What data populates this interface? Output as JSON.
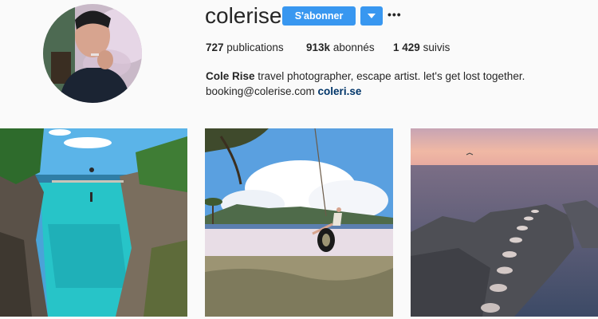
{
  "profile": {
    "username": "colerise",
    "follow_label": "S'abonner",
    "more_label": "•••",
    "stats": {
      "posts_count": "727",
      "posts_label": "publications",
      "followers_count": "913k",
      "followers_label": "abonnés",
      "following_count": "1 429",
      "following_label": "suivis"
    },
    "bio": {
      "full_name": "Cole Rise",
      "text": "travel photographer, escape artist. let's get lost together.",
      "email": "booking@colerise.com",
      "link": "coleri.se"
    }
  },
  "colors": {
    "accent": "#3897f0",
    "link": "#003569",
    "background": "#fafafa"
  },
  "posts": [
    {
      "subject": "turquoise-cliff-jump-photo"
    },
    {
      "subject": "tire-swing-beach-photo"
    },
    {
      "subject": "stepping-stones-sunset-photo"
    }
  ]
}
